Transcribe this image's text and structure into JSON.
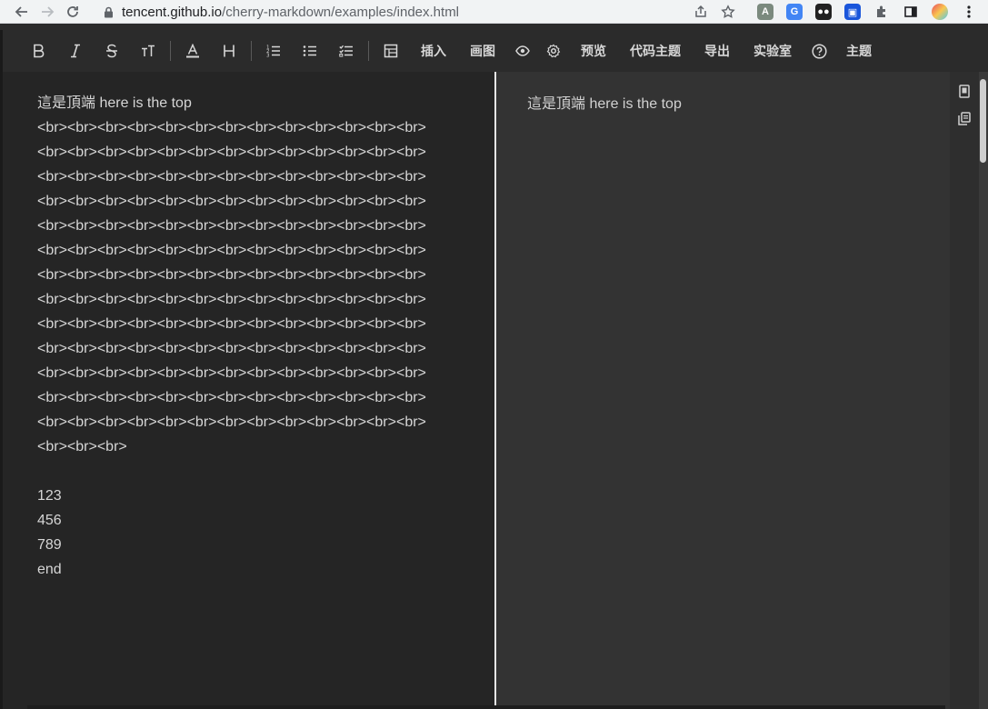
{
  "browser": {
    "url_host": "tencent.github.io",
    "url_path": "/cherry-markdown/examples/index.html"
  },
  "toolbar": {
    "insert": "插入",
    "draw": "画图",
    "preview": "预览",
    "code_theme": "代码主题",
    "export": "导出",
    "lab": "实验室",
    "theme": "主题"
  },
  "editor": {
    "lines": [
      "這是頂端 here is the top",
      "<br><br><br><br><br><br><br><br><br><br><br><br><br>",
      "<br><br><br><br><br><br><br><br><br><br><br><br><br>",
      "<br><br><br><br><br><br><br><br><br><br><br><br><br>",
      "<br><br><br><br><br><br><br><br><br><br><br><br><br>",
      "<br><br><br><br><br><br><br><br><br><br><br><br><br>",
      "<br><br><br><br><br><br><br><br><br><br><br><br><br>",
      "<br><br><br><br><br><br><br><br><br><br><br><br><br>",
      "<br><br><br><br><br><br><br><br><br><br><br><br><br>",
      "<br><br><br><br><br><br><br><br><br><br><br><br><br>",
      "<br><br><br><br><br><br><br><br><br><br><br><br><br>",
      "<br><br><br><br><br><br><br><br><br><br><br><br><br>",
      "<br><br><br><br><br><br><br><br><br><br><br><br><br>",
      "<br><br><br><br><br><br><br><br><br><br><br><br><br>",
      "<br><br><br>",
      "",
      "123",
      "456",
      "789",
      "end"
    ]
  },
  "preview": {
    "text": "這是頂端 here is the top"
  }
}
